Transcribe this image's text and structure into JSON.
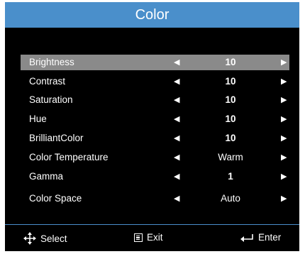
{
  "title": "Color",
  "rows": [
    {
      "label": "Brightness",
      "value": "10"
    },
    {
      "label": "Contrast",
      "value": "10"
    },
    {
      "label": "Saturation",
      "value": "10"
    },
    {
      "label": "Hue",
      "value": "10"
    },
    {
      "label": "BrilliantColor",
      "value": "10"
    },
    {
      "label": "Color Temperature",
      "value": "Warm"
    },
    {
      "label": "Gamma",
      "value": "1"
    },
    {
      "label": "Color Space",
      "value": "Auto"
    }
  ],
  "footer": {
    "select": "Select",
    "exit": "Exit",
    "enter": "Enter"
  },
  "colors": {
    "accent": "#4a8fcb",
    "selected_row": "#8a8a8a",
    "background": "#000000"
  }
}
